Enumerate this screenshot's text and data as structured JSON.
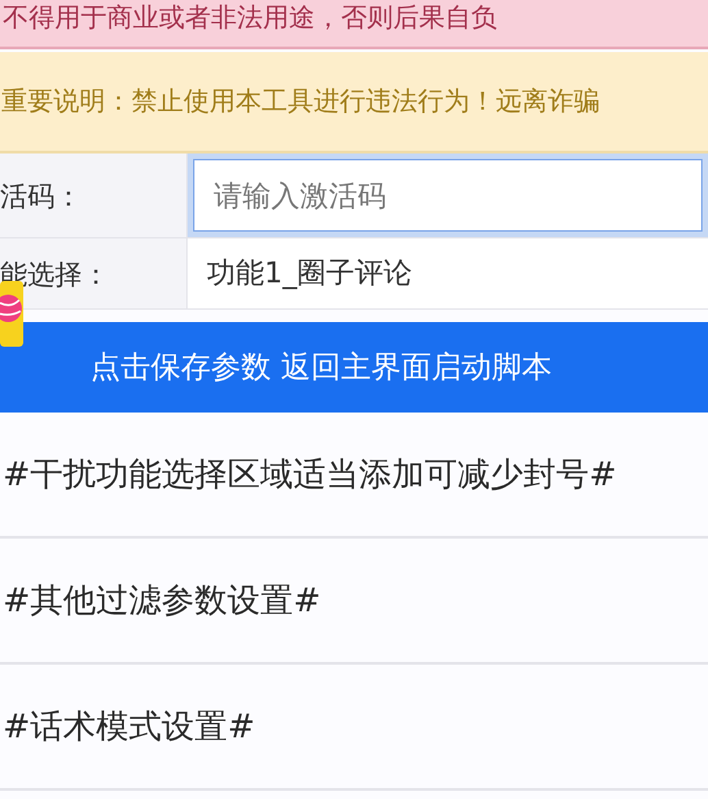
{
  "notice": {
    "text": "不得用于商业或者非法用途，否则后果自负"
  },
  "warning": {
    "text": "重要说明：禁止使用本工具进行违法行为！远离诈骗"
  },
  "form": [
    {
      "kind": "input",
      "label": "活码：",
      "placeholder": "请输入激活码",
      "focused": true
    },
    {
      "kind": "select",
      "label": "能选择：",
      "value": "功能1_圈子评论"
    }
  ],
  "save_button": "点击保存参数 返回主界面启动脚本",
  "sections": [
    "#干扰功能选择区域适当添加可减少封号#",
    "#其他过滤参数设置#",
    "#话术模式设置#"
  ]
}
